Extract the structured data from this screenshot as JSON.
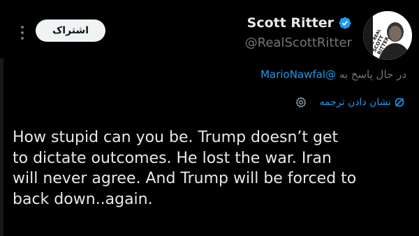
{
  "header": {
    "follow_label": "اشتراک",
    "author_name": "Scott Ritter",
    "author_handle": "@RealScottRitter",
    "avatar_text": {
      "line1": "THE REAL",
      "line2": "SCOTT",
      "line3": "RITTER"
    }
  },
  "reply": {
    "prefix": "در حال پاسخ به",
    "mention": "@MarioNawfal"
  },
  "translate": {
    "label": "نشان دادن ترجمه"
  },
  "tweet": {
    "text": "How stupid can you be. Trump doesn’t get\nto dictate outcomes. He lost the war. Iran\nwill never agree. And Trump will be forced to\nback down..again."
  },
  "colors": {
    "background": "#000000",
    "text": "#e7e9ea",
    "muted": "#71767b",
    "accent": "#1d9bf0"
  },
  "icons": [
    "more-vertical-icon",
    "verified-badge-icon",
    "translate-icon",
    "settings-icon"
  ]
}
